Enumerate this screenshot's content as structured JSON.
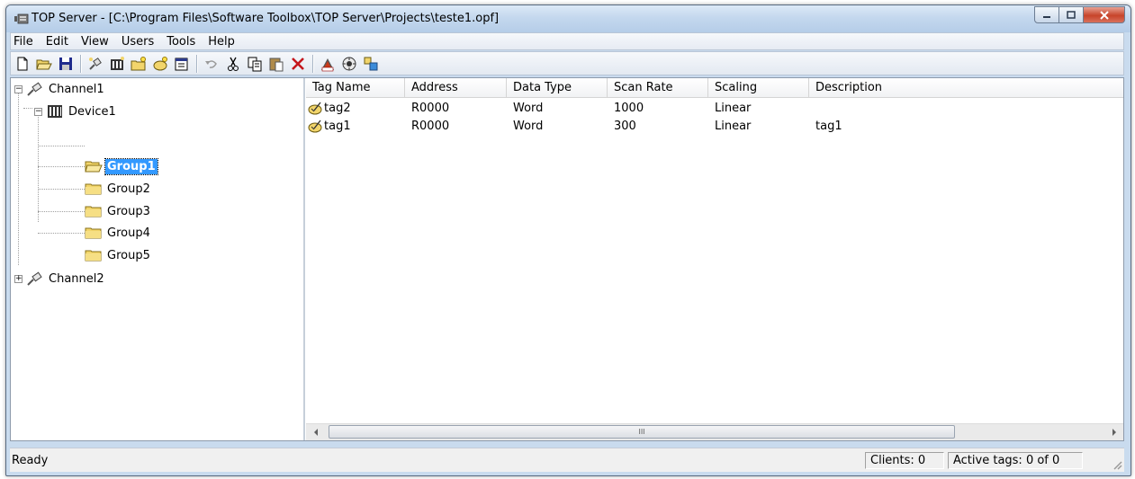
{
  "window": {
    "title": "TOP Server - [C:\\Program Files\\Software Toolbox\\TOP Server\\Projects\\teste1.opf]",
    "app_icon": "top-server-icon"
  },
  "menu": {
    "items": [
      "File",
      "Edit",
      "View",
      "Users",
      "Tools",
      "Help"
    ]
  },
  "toolbar": {
    "buttons": [
      "new-icon",
      "open-icon",
      "save-icon",
      "new-channel-icon",
      "new-device-icon",
      "new-group-icon",
      "new-tag-icon",
      "properties-icon",
      "undo-icon",
      "cut-icon",
      "copy-icon",
      "paste-icon",
      "delete-icon",
      "opc-quick-client-icon",
      "runtime-connect-icon",
      "tag-browse-icon"
    ]
  },
  "tree": {
    "channel1": "Channel1",
    "device1": "Device1",
    "groups": [
      "Group1",
      "Group2",
      "Group3",
      "Group4",
      "Group5"
    ],
    "selected": "Group1",
    "channel2": "Channel2"
  },
  "list": {
    "columns": [
      "Tag Name",
      "Address",
      "Data Type",
      "Scan Rate",
      "Scaling",
      "Description"
    ],
    "rows": [
      {
        "tag_name": "tag2",
        "address": "R0000",
        "data_type": "Word",
        "scan_rate": "1000",
        "scaling": "Linear",
        "description": ""
      },
      {
        "tag_name": "tag1",
        "address": "R0000",
        "data_type": "Word",
        "scan_rate": "300",
        "scaling": "Linear",
        "description": "tag1"
      }
    ],
    "scroll_thumb_glyph": "III"
  },
  "status": {
    "text": "Ready",
    "clients": "Clients: 0",
    "active_tags": "Active tags: 0 of 0"
  },
  "colors": {
    "selection": "#3399ff",
    "folder": "#f2d56b",
    "close_button": "#c7442a"
  }
}
